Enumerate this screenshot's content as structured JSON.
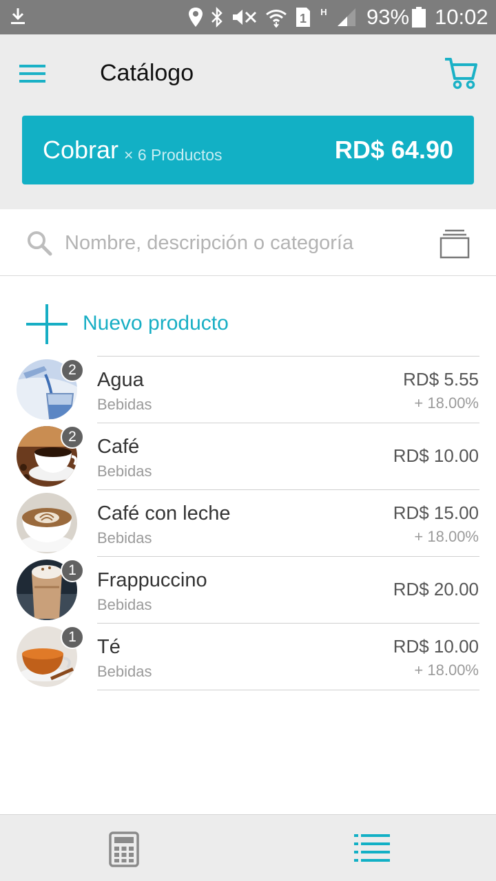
{
  "status_bar": {
    "battery_percent": "93%",
    "time": "10:02",
    "icons": [
      "download-icon",
      "location-icon",
      "bluetooth-icon",
      "mute-icon",
      "wifi-icon",
      "sim-1-icon",
      "h-network-icon",
      "signal-icon",
      "battery-icon"
    ],
    "sim_label": "1",
    "network_label": "H"
  },
  "header": {
    "title": "Catálogo",
    "menu_icon": "menu-icon",
    "cart_icon": "cart-icon"
  },
  "charge": {
    "label": "Cobrar",
    "count": "× 6 Productos",
    "total": "RD$ 64.90"
  },
  "search": {
    "placeholder": "Nombre, descripción o categoría",
    "value": ""
  },
  "new_product": {
    "label": "Nuevo producto"
  },
  "products": [
    {
      "name": "Agua",
      "category": "Bebidas",
      "price": "RD$ 5.55",
      "tax": "+ 18.00%",
      "qty": "2",
      "image": "water-glass"
    },
    {
      "name": "Café",
      "category": "Bebidas",
      "price": "RD$ 10.00",
      "tax": "",
      "qty": "2",
      "image": "coffee-cup"
    },
    {
      "name": "Café con leche",
      "category": "Bebidas",
      "price": "RD$ 15.00",
      "tax": "+ 18.00%",
      "qty": "",
      "image": "latte-cup"
    },
    {
      "name": "Frappuccino",
      "category": "Bebidas",
      "price": "RD$ 20.00",
      "tax": "",
      "qty": "1",
      "image": "frappuccino-glass"
    },
    {
      "name": "Té",
      "category": "Bebidas",
      "price": "RD$ 10.00",
      "tax": "+ 18.00%",
      "qty": "1",
      "image": "tea-cup"
    }
  ],
  "bottom_nav": {
    "items": [
      "calculator-icon",
      "list-icon"
    ],
    "active": "list-icon"
  },
  "colors": {
    "accent": "#12b0c5",
    "statusbar": "#7d7d7d",
    "header_bg": "#ececec",
    "badge": "#616161"
  }
}
